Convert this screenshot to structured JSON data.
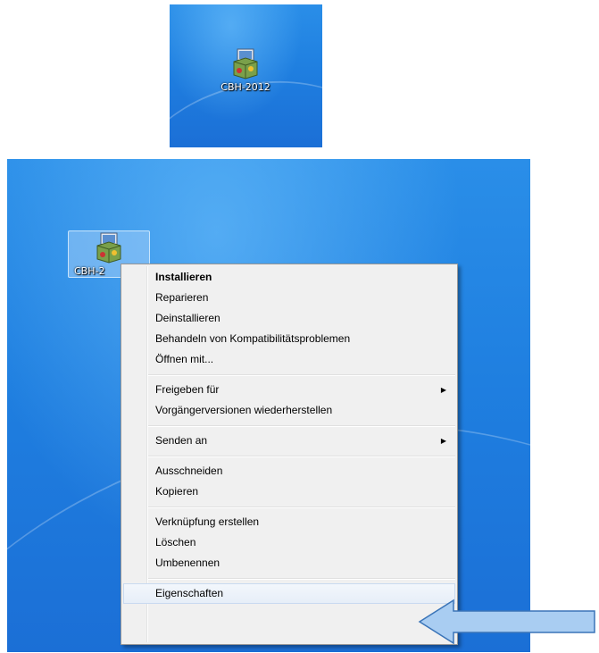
{
  "desktop_icon": {
    "label": "CBH-2012",
    "label_truncated": "CBH-2",
    "icon": "installer-package-icon"
  },
  "context_menu": {
    "groups": [
      [
        {
          "label": "Installieren",
          "default": true
        },
        {
          "label": "Reparieren"
        },
        {
          "label": "Deinstallieren"
        },
        {
          "label": "Behandeln von Kompatibilitätsproblemen"
        },
        {
          "label": "Öffnen mit..."
        }
      ],
      [
        {
          "label": "Freigeben für",
          "submenu": true
        },
        {
          "label": "Vorgängerversionen wiederherstellen"
        }
      ],
      [
        {
          "label": "Senden an",
          "submenu": true
        }
      ],
      [
        {
          "label": "Ausschneiden"
        },
        {
          "label": "Kopieren"
        }
      ],
      [
        {
          "label": "Verknüpfung erstellen"
        },
        {
          "label": "Löschen"
        },
        {
          "label": "Umbenennen"
        }
      ],
      [
        {
          "label": "Eigenschaften",
          "highlighted": true
        }
      ]
    ]
  },
  "annotation": {
    "arrow_icon": "left-arrow-callout-icon",
    "color": "#a9cdf2"
  }
}
